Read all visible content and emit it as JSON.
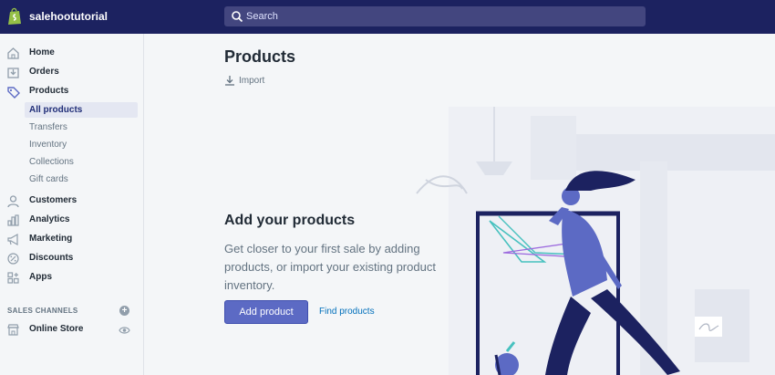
{
  "topbar": {
    "store_name": "salehootutorial",
    "search_placeholder": "Search",
    "logo_icon": "shopify-bag-icon",
    "colors": {
      "bar": "#1c2260",
      "search": "#43467f"
    }
  },
  "sidebar": {
    "nav": [
      {
        "label": "Home",
        "icon": "home-icon"
      },
      {
        "label": "Orders",
        "icon": "orders-icon"
      },
      {
        "label": "Products",
        "icon": "tag-icon"
      }
    ],
    "products_sub": [
      {
        "label": "All products",
        "active": true
      },
      {
        "label": "Transfers"
      },
      {
        "label": "Inventory"
      },
      {
        "label": "Collections"
      },
      {
        "label": "Gift cards"
      }
    ],
    "nav2": [
      {
        "label": "Customers",
        "icon": "person-icon"
      },
      {
        "label": "Analytics",
        "icon": "bar-chart-icon"
      },
      {
        "label": "Marketing",
        "icon": "megaphone-icon"
      },
      {
        "label": "Discounts",
        "icon": "discount-icon"
      },
      {
        "label": "Apps",
        "icon": "apps-icon"
      }
    ],
    "sales_channels_title": "SALES CHANNELS",
    "channel": {
      "label": "Online Store",
      "icon": "store-icon"
    }
  },
  "main": {
    "title": "Products",
    "import_label": "Import",
    "empty_title": "Add your products",
    "empty_body": "Get closer to your first sale by adding products, or import your existing product inventory.",
    "primary_button": "Add product",
    "secondary_link": "Find products",
    "colors": {
      "accent": "#5c6ac4",
      "link": "#006fbb"
    }
  }
}
